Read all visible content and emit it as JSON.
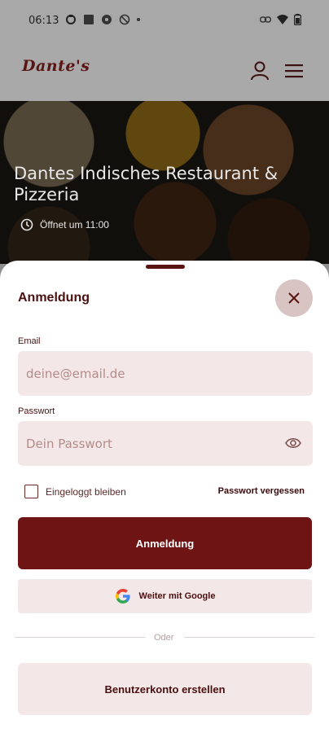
{
  "status_bar": {
    "time": "06:13",
    "icons": [
      "sync-icon",
      "app-icon",
      "alert-icon",
      "dnd-icon",
      "link-icon",
      "wifi-icon",
      "battery-icon"
    ]
  },
  "header": {
    "logo_text": "Dante's",
    "icons": [
      "user-icon",
      "hamburger-menu-icon"
    ]
  },
  "hero": {
    "title": "Dantes Indisches Restaurant & Pizzeria",
    "hours": "Öffnet um 11:00"
  },
  "login_sheet": {
    "title": "Anmeldung",
    "email": {
      "label": "Email",
      "placeholder": "deine@email.de",
      "value": ""
    },
    "password": {
      "label": "Passwort",
      "placeholder": "Dein Passwort",
      "value": ""
    },
    "remember_label": "Eingeloggt bleiben",
    "remember_checked": false,
    "forgot_label": "Passwort vergessen",
    "login_button": "Anmeldung",
    "google_button": "Weiter mit Google",
    "divider_text": "Oder",
    "create_account_button": "Benutzerkonto erstellen"
  },
  "colors": {
    "primary": "#6e1414",
    "field_bg": "#f3e8e7",
    "close_bg": "#d9c4c4"
  }
}
